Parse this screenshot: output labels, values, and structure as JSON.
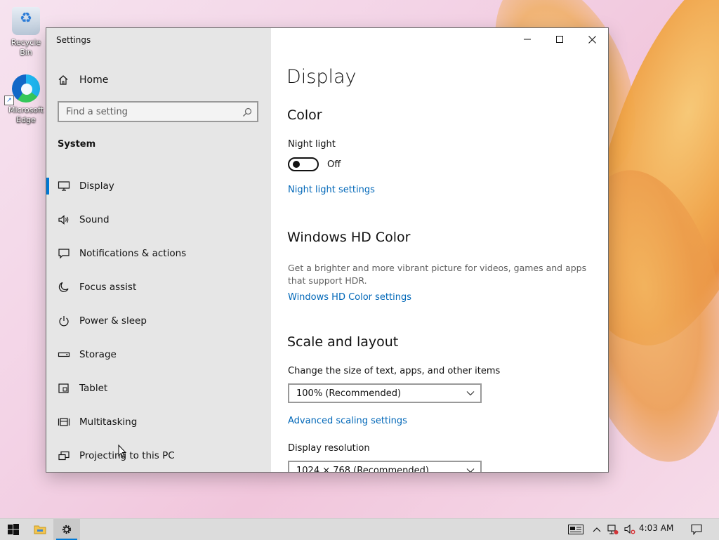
{
  "desktop": {
    "icons": [
      {
        "label": "Recycle Bin"
      },
      {
        "label": "Microsoft Edge"
      }
    ]
  },
  "window": {
    "title": "Settings",
    "sidebar": {
      "home_label": "Home",
      "search_placeholder": "Find a setting",
      "section_label": "System",
      "items": [
        {
          "label": "Display",
          "icon": "monitor-icon",
          "active": true
        },
        {
          "label": "Sound",
          "icon": "speaker-icon"
        },
        {
          "label": "Notifications & actions",
          "icon": "message-icon"
        },
        {
          "label": "Focus assist",
          "icon": "moon-icon"
        },
        {
          "label": "Power & sleep",
          "icon": "power-icon"
        },
        {
          "label": "Storage",
          "icon": "storage-icon"
        },
        {
          "label": "Tablet",
          "icon": "tablet-icon"
        },
        {
          "label": "Multitasking",
          "icon": "multitasking-icon"
        },
        {
          "label": "Projecting to this PC",
          "icon": "projecting-icon"
        }
      ]
    },
    "content": {
      "page_title": "Display",
      "color": {
        "heading": "Color",
        "night_light_label": "Night light",
        "night_light_state": "Off",
        "night_light_link": "Night light settings"
      },
      "hd_color": {
        "heading": "Windows HD Color",
        "description": "Get a brighter and more vibrant picture for videos, games and apps that support HDR.",
        "link": "Windows HD Color settings"
      },
      "scale": {
        "heading": "Scale and layout",
        "size_label": "Change the size of text, apps, and other items",
        "size_value": "100% (Recommended)",
        "advanced_link": "Advanced scaling settings",
        "resolution_label": "Display resolution",
        "resolution_value": "1024 × 768 (Recommended)"
      }
    }
  },
  "taskbar": {
    "time": "4:03 AM"
  },
  "colors": {
    "accent": "#0078d4",
    "link": "#0067b8",
    "sidebar_bg": "#e6e6e6"
  }
}
